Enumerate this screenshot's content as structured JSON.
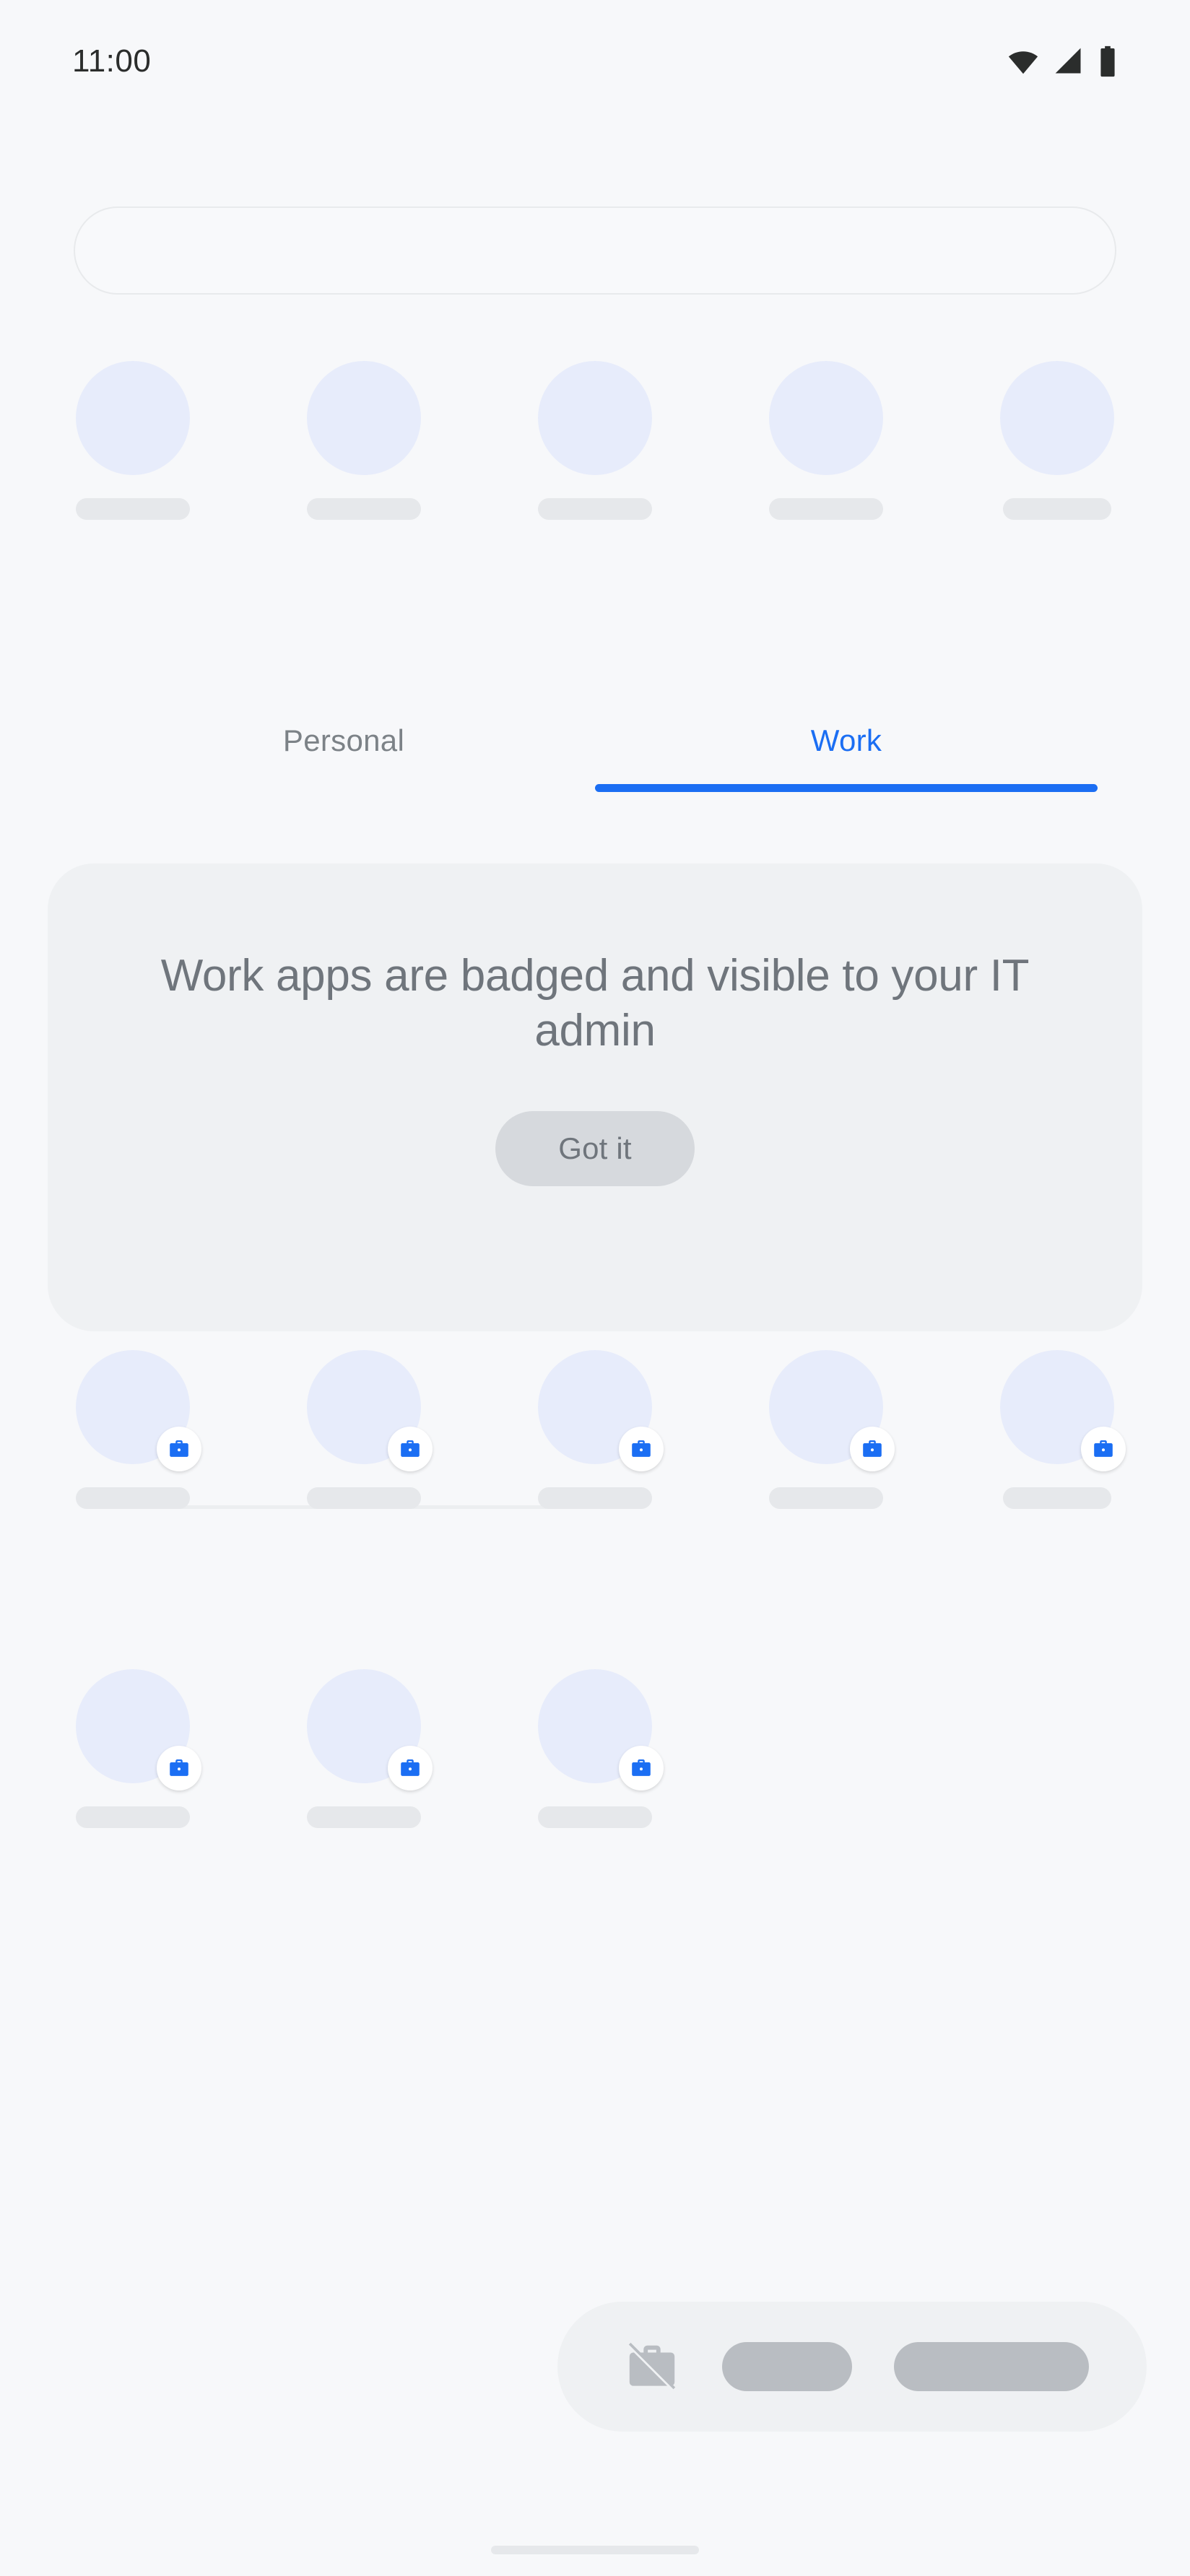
{
  "status_bar": {
    "time": "11:00",
    "icons": [
      "wifi-icon",
      "cell-signal-icon",
      "battery-icon"
    ]
  },
  "search": {
    "value": "",
    "placeholder": ""
  },
  "personal_apps_row": {
    "items": [
      {
        "icon": "app-placeholder-icon",
        "label": ""
      },
      {
        "icon": "app-placeholder-icon",
        "label": ""
      },
      {
        "icon": "app-placeholder-icon",
        "label": ""
      },
      {
        "icon": "app-placeholder-icon",
        "label": ""
      },
      {
        "icon": "app-placeholder-icon",
        "label": ""
      }
    ]
  },
  "tabs": {
    "personal_label": "Personal",
    "work_label": "Work",
    "active": "Work",
    "active_color": "#1b6ef3",
    "inactive_color": "#7c8287"
  },
  "info_card": {
    "title": "Work apps are badged and visible to your IT admin",
    "button_label": "Got it",
    "background": "#eff1f3",
    "text_color": "#6f757c"
  },
  "work_apps": {
    "badge_icon": "briefcase-badge-icon",
    "badge_color": "#1b6ef3",
    "row1": [
      {
        "icon": "app-placeholder-icon",
        "label": ""
      },
      {
        "icon": "app-placeholder-icon",
        "label": ""
      },
      {
        "icon": "app-placeholder-icon",
        "label": ""
      },
      {
        "icon": "app-placeholder-icon",
        "label": ""
      },
      {
        "icon": "app-placeholder-icon",
        "label": ""
      }
    ],
    "row2": [
      {
        "icon": "app-placeholder-icon",
        "label": ""
      },
      {
        "icon": "app-placeholder-icon",
        "label": ""
      },
      {
        "icon": "app-placeholder-icon",
        "label": ""
      }
    ]
  },
  "work_bar": {
    "icon": "work-off-icon",
    "background": "#eff1f3"
  },
  "nav_handle": {
    "label": ""
  },
  "colors": {
    "page_background": "#f7f8fa",
    "app_icon_placeholder": "#e7ecfb",
    "label_placeholder": "#e6e8eb",
    "accent_blue": "#1b6ef3"
  }
}
